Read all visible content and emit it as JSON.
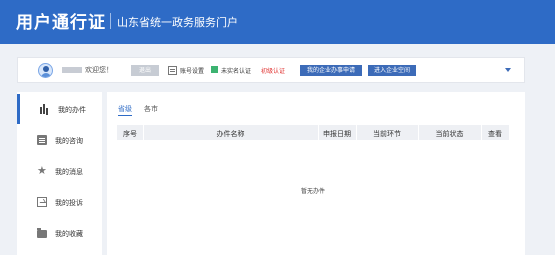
{
  "header": {
    "title": "用户通行证",
    "subtitle": "山东省统一政务服务门户",
    "background": "#2e6bc6"
  },
  "userbar": {
    "welcome": "欢迎您！",
    "logout_label": "退出",
    "account_settings": "账号设置",
    "verification_status": "未实名认证",
    "verification_level": "初级认证",
    "enterprise_apply_button": "我的企业办事申请",
    "enterprise_space_button": "进入企业空间"
  },
  "sidebar": {
    "items": [
      {
        "label": "我的办件",
        "icon": "bar-chart-icon",
        "active": true
      },
      {
        "label": "我的咨询",
        "icon": "document-icon",
        "active": false
      },
      {
        "label": "我的消息",
        "icon": "star-icon",
        "active": false
      },
      {
        "label": "我的投诉",
        "icon": "complaint-icon",
        "active": false
      },
      {
        "label": "我的收藏",
        "icon": "folder-icon",
        "active": false
      }
    ]
  },
  "main": {
    "tabs": [
      {
        "label": "省级",
        "active": true
      },
      {
        "label": "各市",
        "active": false
      }
    ],
    "table": {
      "columns": [
        "序号",
        "办件名称",
        "申报日期",
        "当前环节",
        "当前状态",
        "查看"
      ],
      "rows": []
    },
    "empty_message": "暂无办件"
  },
  "colors": {
    "accent": "#2e6bc6",
    "warning_text": "#e0302e",
    "button_blue": "#3c6bb8",
    "verified_green": "#3cb371"
  }
}
